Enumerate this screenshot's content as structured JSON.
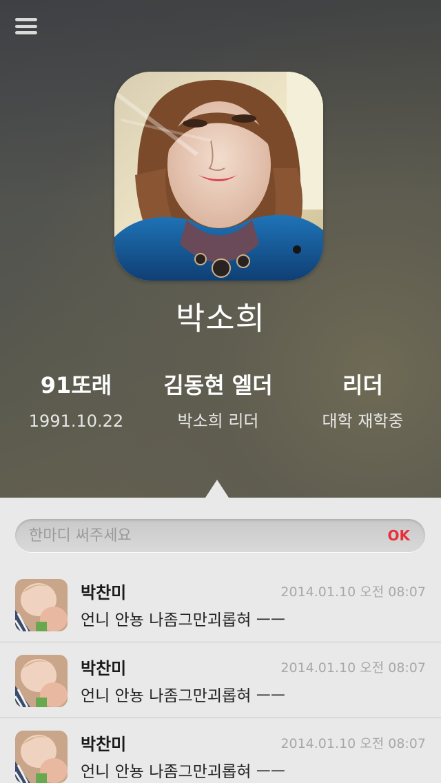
{
  "header": {
    "menu_icon": "hamburger-menu-icon"
  },
  "profile": {
    "name": "박소희",
    "stats": [
      {
        "main": "91또래",
        "sub": "1991.10.22"
      },
      {
        "main": "김동현 엘더",
        "sub": "박소희 리더"
      },
      {
        "main": "리더",
        "sub": "대학 재학중"
      }
    ]
  },
  "comment_input": {
    "placeholder": "한마디 써주세요",
    "submit_label": "OK"
  },
  "comments": [
    {
      "author": "박찬미",
      "time": "2014.01.10 오전 08:07",
      "text": "언니 안뇽 나좀그만괴롭혀 ㅡㅡ"
    },
    {
      "author": "박찬미",
      "time": "2014.01.10 오전 08:07",
      "text": "언니 안뇽 나좀그만괴롭혀 ㅡㅡ"
    },
    {
      "author": "박찬미",
      "time": "2014.01.10 오전 08:07",
      "text": "언니 안뇽 나좀그만괴롭혀 ㅡㅡ"
    }
  ],
  "colors": {
    "accent": "#e8303a",
    "panel_bg": "#e9e9ea"
  }
}
